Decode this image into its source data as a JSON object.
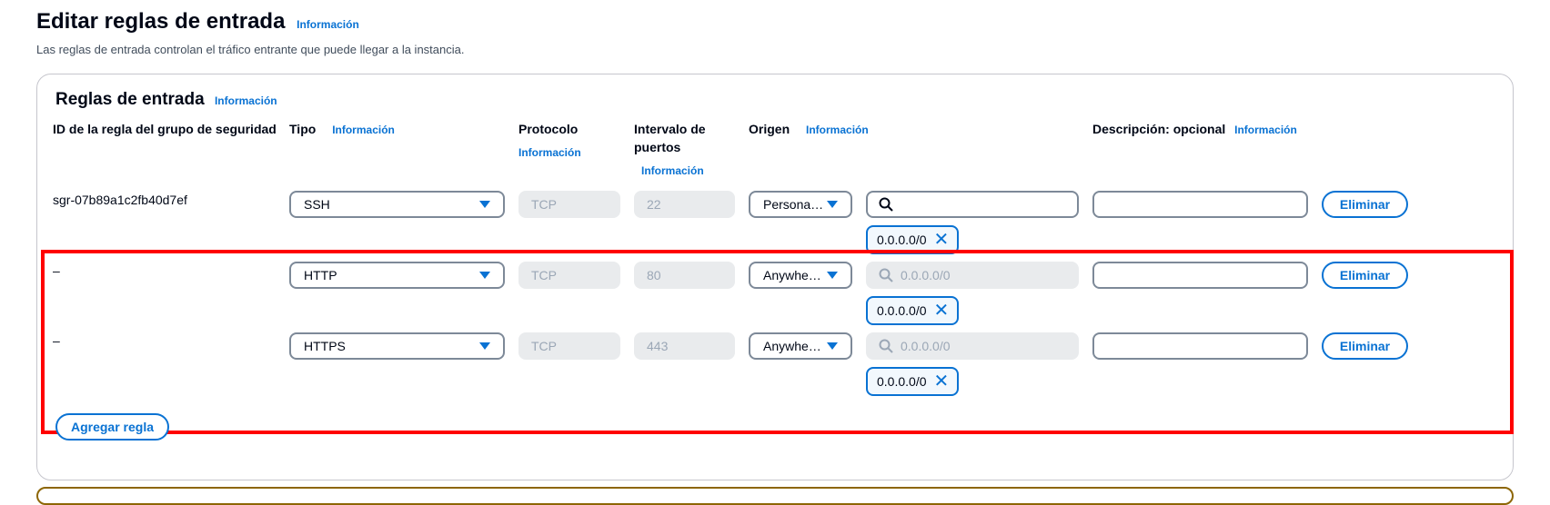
{
  "page": {
    "title": "Editar reglas de entrada",
    "title_info": "Información",
    "subtitle": "Las reglas de entrada controlan el tráfico entrante que puede llegar a la instancia."
  },
  "panel": {
    "title": "Reglas de entrada",
    "title_info": "Información",
    "columns": {
      "rule_id": "ID de la regla del grupo de seguridad",
      "type": "Tipo",
      "type_info": "Información",
      "protocol": "Protocolo",
      "protocol_info": "Información",
      "port_range_line1": "Intervalo de",
      "port_range_line2": "puertos",
      "port_range_info": "Información",
      "source": "Origen",
      "source_info": "Información",
      "description": "Descripción: opcional",
      "description_info": "Información"
    },
    "rules": [
      {
        "id": "sgr-07b89a1c2fb40d7ef",
        "type": "SSH",
        "protocol": "TCP",
        "port": "22",
        "source": "Persona…",
        "search_placeholder": "",
        "token": "0.0.0.0/0",
        "delete_label": "Eliminar"
      },
      {
        "id": "–",
        "type": "HTTP",
        "protocol": "TCP",
        "port": "80",
        "source": "Anywhe…",
        "search_placeholder": "0.0.0.0/0",
        "token": "0.0.0.0/0",
        "delete_label": "Eliminar"
      },
      {
        "id": "–",
        "type": "HTTPS",
        "protocol": "TCP",
        "port": "443",
        "source": "Anywhe…",
        "search_placeholder": "0.0.0.0/0",
        "token": "0.0.0.0/0",
        "delete_label": "Eliminar"
      }
    ],
    "add_rule_label": "Agregar regla"
  },
  "colors": {
    "link": "#0972d3",
    "highlight": "#ff0000",
    "disabled_bg": "#e9ebed"
  },
  "icons": {
    "search": "search-icon",
    "dropdown": "caret-down-icon",
    "dismiss": "close-icon"
  }
}
